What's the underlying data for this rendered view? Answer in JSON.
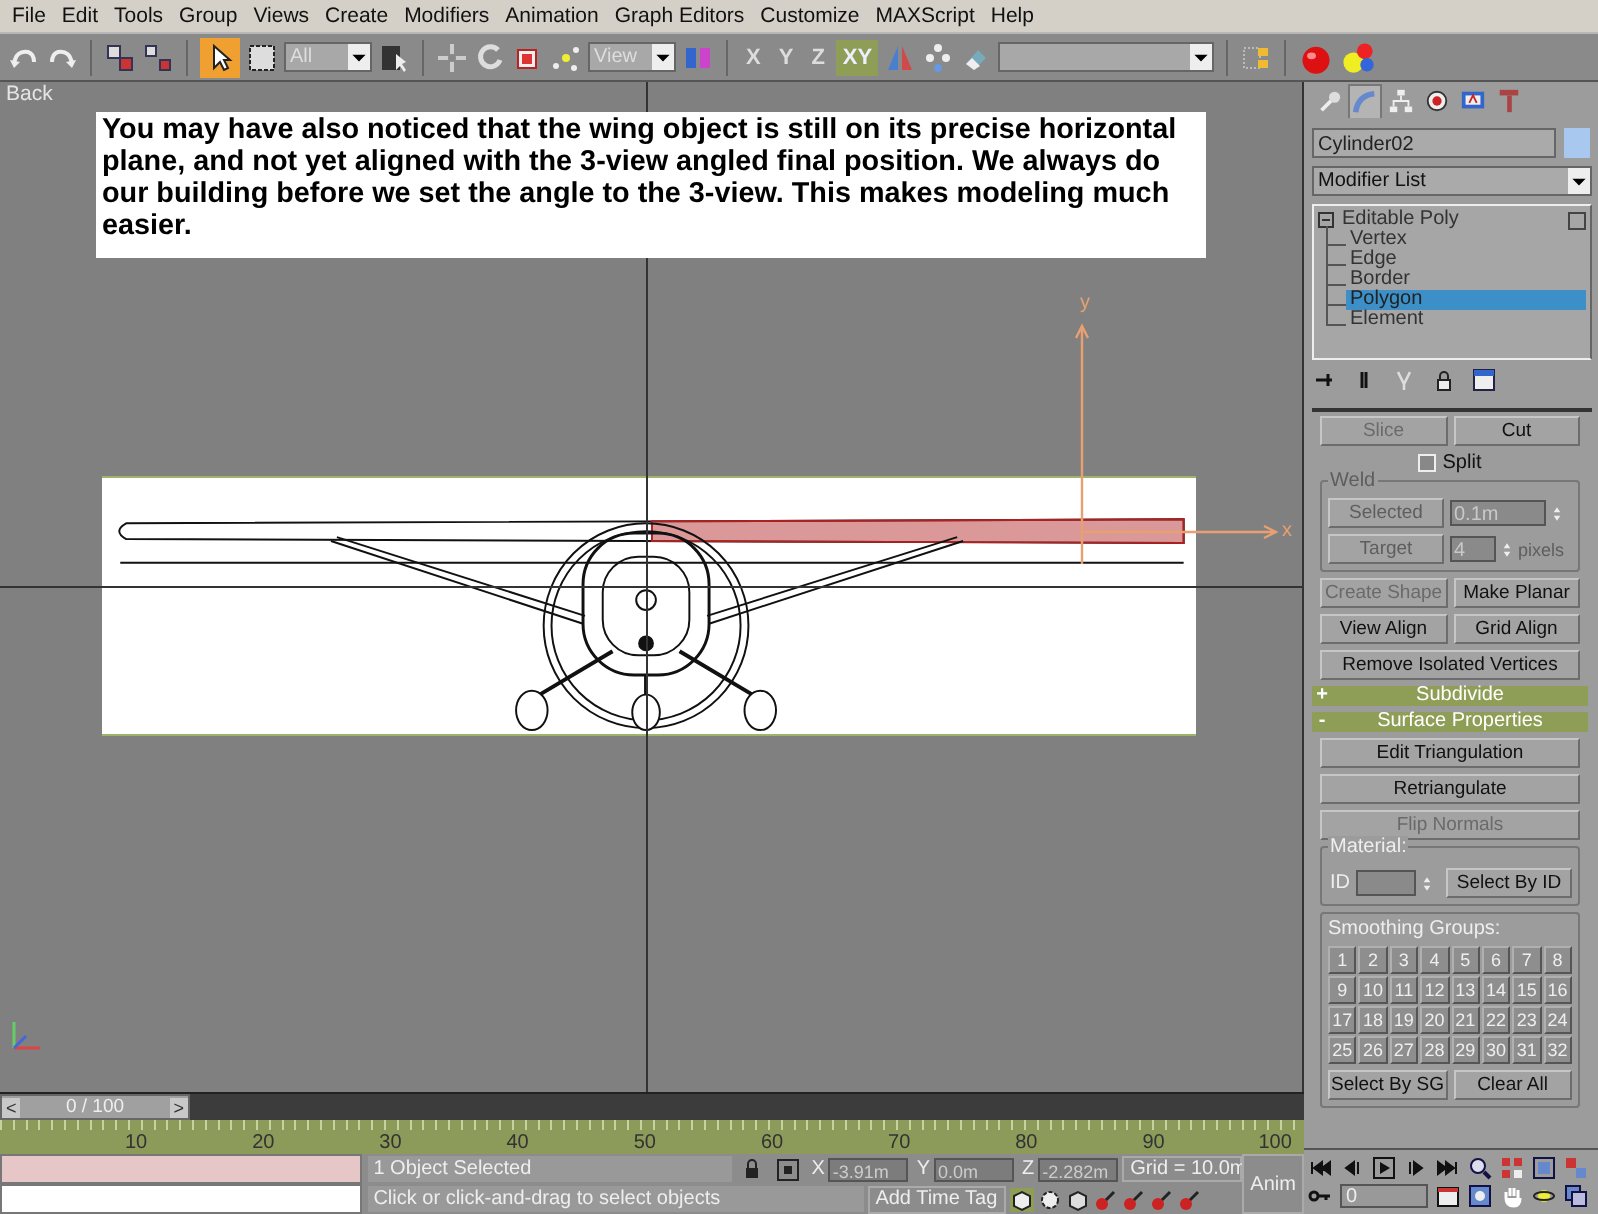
{
  "menu": [
    "File",
    "Edit",
    "Tools",
    "Group",
    "Views",
    "Create",
    "Modifiers",
    "Animation",
    "Graph Editors",
    "Customize",
    "MAXScript",
    "Help"
  ],
  "toolbar": {
    "select_tool": {
      "selected": true
    },
    "selection_filter": "All",
    "coordinate_system": "View",
    "axes": [
      {
        "label": "X",
        "selected": false
      },
      {
        "label": "Y",
        "selected": false
      },
      {
        "label": "Z",
        "selected": false
      },
      {
        "label": "XY",
        "selected": true
      }
    ]
  },
  "viewport": {
    "label": "Back",
    "note": "You may have also noticed that the wing object is still on its precise horizontal plane, and not yet aligned with the 3-view angled final position.  We always do our building before we set the angle to the 3-view.  This makes modeling much easier.",
    "gizmo": {
      "y_label": "y",
      "x_label": "x"
    }
  },
  "command_panel": {
    "tabs": [
      {
        "kind": "create",
        "selected": false
      },
      {
        "kind": "modify",
        "selected": true
      },
      {
        "kind": "hierarchy",
        "selected": false
      },
      {
        "kind": "motion",
        "selected": false
      },
      {
        "kind": "display",
        "selected": false
      },
      {
        "kind": "utilities",
        "selected": false
      }
    ],
    "object_name": "Cylinder02",
    "modifier_list": "Modifier List",
    "stack": [
      {
        "label": "Editable Poly",
        "expanded": true,
        "children": [
          {
            "label": "Vertex",
            "selected": false
          },
          {
            "label": "Edge",
            "selected": false
          },
          {
            "label": "Border",
            "selected": false
          },
          {
            "label": "Polygon",
            "selected": true
          },
          {
            "label": "Element",
            "selected": false
          }
        ]
      }
    ],
    "edit_geometry": {
      "row1": [
        {
          "label": "Slice",
          "disabled": true
        },
        {
          "label": "Cut",
          "disabled": false
        }
      ],
      "split": {
        "label": "Split",
        "checked": false
      },
      "weld": {
        "title": "Weld",
        "disabled": true,
        "rows": [
          {
            "button": "Selected",
            "value": "0.1m"
          },
          {
            "button": "Target",
            "value": "4",
            "unit": "pixels"
          }
        ]
      },
      "buttons": [
        {
          "label": "Create Shape",
          "disabled": true,
          "wide": false
        },
        {
          "label": "Make Planar",
          "disabled": false,
          "wide": false
        },
        {
          "label": "View Align",
          "disabled": false,
          "wide": false
        },
        {
          "label": "Grid Align",
          "disabled": false,
          "wide": false
        },
        {
          "label": "Remove Isolated Vertices",
          "disabled": false,
          "wide": true
        }
      ]
    },
    "rollouts": [
      {
        "sign": "+",
        "title": "Subdivide"
      },
      {
        "sign": "-",
        "title": "Surface Properties"
      }
    ],
    "surface_properties": {
      "buttons": [
        {
          "label": "Edit Triangulation",
          "disabled": false
        },
        {
          "label": "Retriangulate",
          "disabled": false
        },
        {
          "label": "Flip Normals",
          "disabled": true
        }
      ],
      "material": {
        "title": "Material:",
        "id_label": "ID",
        "button": "Select By ID"
      },
      "smoothing": {
        "title": "Smoothing Groups:",
        "groups": [
          "1",
          "2",
          "3",
          "4",
          "5",
          "6",
          "7",
          "8",
          "9",
          "10",
          "11",
          "12",
          "13",
          "14",
          "15",
          "16",
          "17",
          "18",
          "19",
          "20",
          "21",
          "22",
          "23",
          "24",
          "25",
          "26",
          "27",
          "28",
          "29",
          "30",
          "31",
          "32"
        ],
        "buttons": [
          "Select By SG",
          "Clear All"
        ]
      }
    }
  },
  "time_slider": {
    "level": 0,
    "prev": "<",
    "label": "0 / 100",
    "next": ">"
  },
  "track_bar": {
    "labels": [
      "10",
      "20",
      "30",
      "40",
      "50",
      "60",
      "70",
      "80",
      "90",
      "100"
    ]
  },
  "status": {
    "selection": "1 Object Selected",
    "prompt": "Click or click-and-drag to select objects",
    "coords": [
      {
        "axis": "X",
        "value": "-3.91m"
      },
      {
        "axis": "Y",
        "value": "0.0m"
      },
      {
        "axis": "Z",
        "value": "-2.282m"
      }
    ],
    "grid": "Grid = 10.0m",
    "time_tag": "Add Time Tag",
    "anim": "Anim"
  },
  "playback": {
    "frame": "0"
  }
}
